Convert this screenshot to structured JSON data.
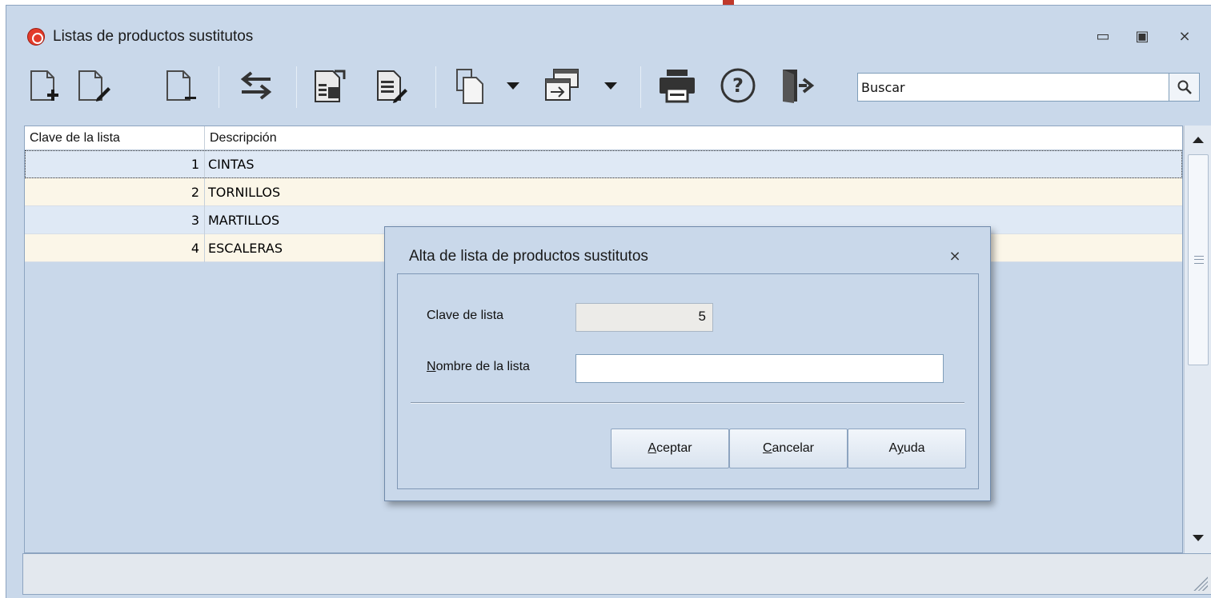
{
  "window": {
    "title": "Listas de productos sustitutos",
    "minimize_glyph": "▭",
    "maximize_glyph": "▣",
    "close_glyph": "⨯"
  },
  "toolbar": {
    "buttons": [
      {
        "name": "new-document-icon"
      },
      {
        "name": "edit-document-icon"
      },
      {
        "name": "delete-document-icon"
      },
      {
        "name": "swap-arrows-icon"
      },
      {
        "name": "import-document-icon"
      },
      {
        "name": "list-edit-icon"
      },
      {
        "name": "copy-icon"
      },
      {
        "name": "dropdown-arrow-icon"
      },
      {
        "name": "window-transfer-icon"
      },
      {
        "name": "dropdown-arrow-icon"
      },
      {
        "name": "printer-icon"
      },
      {
        "name": "help-icon"
      },
      {
        "name": "exit-door-icon"
      }
    ],
    "search": {
      "value": "Buscar"
    }
  },
  "grid": {
    "columns": [
      "Clave de la lista",
      "Descripción"
    ],
    "rows": [
      {
        "key": "1",
        "desc": "CINTAS"
      },
      {
        "key": "2",
        "desc": "TORNILLOS"
      },
      {
        "key": "3",
        "desc": "MARTILLOS"
      },
      {
        "key": "4",
        "desc": "ESCALERAS"
      }
    ]
  },
  "dialog": {
    "title": "Alta de lista de productos sustitutos",
    "close_glyph": "⨯",
    "key_label": "Clave de lista",
    "key_value": "5",
    "name_label_accel": "N",
    "name_label_rest": "ombre de la lista",
    "name_value": "",
    "ok_accel": "A",
    "ok_rest": "ceptar",
    "cancel_accel": "C",
    "cancel_rest": "ancelar",
    "help_pre": "A",
    "help_accel": "y",
    "help_rest": "uda"
  },
  "colors": {
    "window_bg": "#c9d8ea",
    "row_odd": "#dfe9f5",
    "row_even": "#fbf6e8",
    "app_icon": "#e23b2a"
  }
}
